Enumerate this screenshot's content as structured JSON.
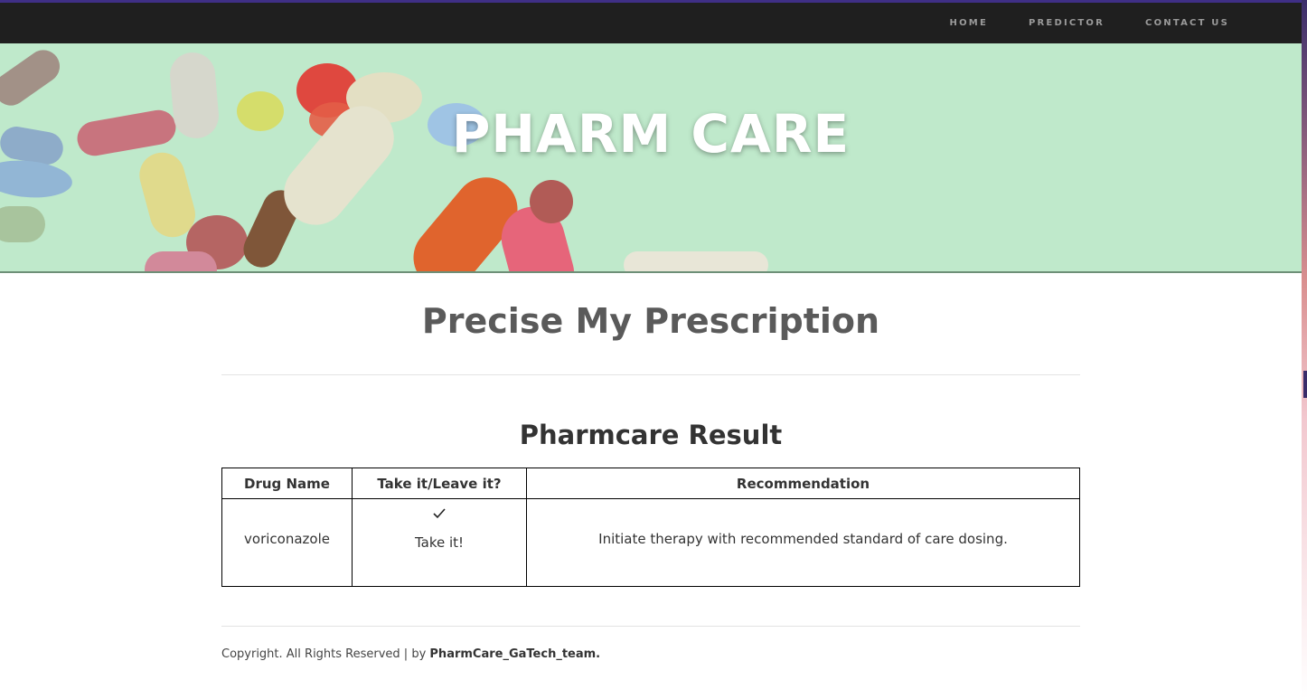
{
  "nav": {
    "items": [
      {
        "label": "HOME"
      },
      {
        "label": "PREDICTOR"
      },
      {
        "label": "CONTACT US"
      }
    ]
  },
  "hero": {
    "title": "PHARM CARE"
  },
  "main": {
    "heading": "Precise My Prescription",
    "result_heading": "Pharmcare Result",
    "table": {
      "headers": [
        "Drug Name",
        "Take it/Leave it?",
        "Recommendation"
      ],
      "rows": [
        {
          "drug_name": "voriconazole",
          "decision_icon": "checkmark-icon",
          "decision": "Take it!",
          "recommendation": "Initiate therapy with recommended standard of care dosing."
        }
      ]
    }
  },
  "footer": {
    "text": "Copyright. All Rights Reserved | by ",
    "team": "PharmCare_GaTech_team."
  },
  "colors": {
    "topbar_bg": "#1f1f1f",
    "topbar_accent": "#3f2f86",
    "hero_bg": "#bfeacb",
    "heading": "#5a5a5a"
  }
}
